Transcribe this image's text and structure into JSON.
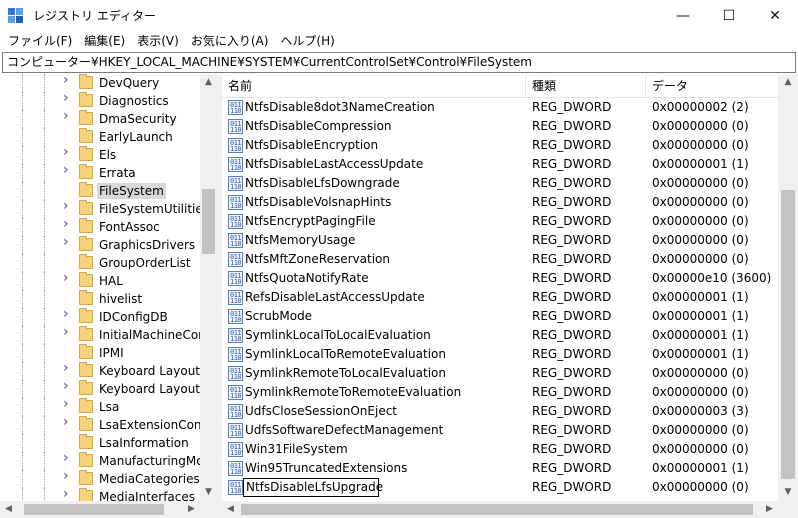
{
  "window": {
    "title": "レジストリ エディター",
    "minimize_glyph": "—",
    "maximize_glyph": "☐",
    "close_glyph": "✕"
  },
  "menu": [
    "ファイル(F)",
    "編集(E)",
    "表示(V)",
    "お気に入り(A)",
    "ヘルプ(H)"
  ],
  "address": "コンピューター¥HKEY_LOCAL_MACHINE¥SYSTEM¥CurrentControlSet¥Control¥FileSystem",
  "tree": {
    "items": [
      {
        "label": "DevQuery",
        "expandable": true
      },
      {
        "label": "Diagnostics",
        "expandable": true
      },
      {
        "label": "DmaSecurity",
        "expandable": true
      },
      {
        "label": "EarlyLaunch",
        "expandable": false
      },
      {
        "label": "Els",
        "expandable": true
      },
      {
        "label": "Errata",
        "expandable": true
      },
      {
        "label": "FileSystem",
        "expandable": false,
        "selected": true
      },
      {
        "label": "FileSystemUtilities",
        "expandable": true
      },
      {
        "label": "FontAssoc",
        "expandable": true
      },
      {
        "label": "GraphicsDrivers",
        "expandable": true
      },
      {
        "label": "GroupOrderList",
        "expandable": false
      },
      {
        "label": "HAL",
        "expandable": true
      },
      {
        "label": "hivelist",
        "expandable": false
      },
      {
        "label": "IDConfigDB",
        "expandable": true
      },
      {
        "label": "InitialMachineConf",
        "expandable": true
      },
      {
        "label": "IPMI",
        "expandable": false
      },
      {
        "label": "Keyboard Layout",
        "expandable": true
      },
      {
        "label": "Keyboard Layouts",
        "expandable": true
      },
      {
        "label": "Lsa",
        "expandable": true
      },
      {
        "label": "LsaExtensionConfig",
        "expandable": true
      },
      {
        "label": "LsaInformation",
        "expandable": false
      },
      {
        "label": "ManufacturingMod",
        "expandable": true
      },
      {
        "label": "MediaCategories",
        "expandable": true
      },
      {
        "label": "MediaInterfaces",
        "expandable": true
      }
    ]
  },
  "list": {
    "columns": {
      "name": "名前",
      "type": "種類",
      "data": "データ"
    },
    "rows": [
      {
        "name": "NtfsDisable8dot3NameCreation",
        "type": "REG_DWORD",
        "data": "0x00000002 (2)"
      },
      {
        "name": "NtfsDisableCompression",
        "type": "REG_DWORD",
        "data": "0x00000000 (0)"
      },
      {
        "name": "NtfsDisableEncryption",
        "type": "REG_DWORD",
        "data": "0x00000000 (0)"
      },
      {
        "name": "NtfsDisableLastAccessUpdate",
        "type": "REG_DWORD",
        "data": "0x00000001 (1)"
      },
      {
        "name": "NtfsDisableLfsDowngrade",
        "type": "REG_DWORD",
        "data": "0x00000000 (0)"
      },
      {
        "name": "NtfsDisableVolsnapHints",
        "type": "REG_DWORD",
        "data": "0x00000000 (0)"
      },
      {
        "name": "NtfsEncryptPagingFile",
        "type": "REG_DWORD",
        "data": "0x00000000 (0)"
      },
      {
        "name": "NtfsMemoryUsage",
        "type": "REG_DWORD",
        "data": "0x00000000 (0)"
      },
      {
        "name": "NtfsMftZoneReservation",
        "type": "REG_DWORD",
        "data": "0x00000000 (0)"
      },
      {
        "name": "NtfsQuotaNotifyRate",
        "type": "REG_DWORD",
        "data": "0x00000e10 (3600)"
      },
      {
        "name": "RefsDisableLastAccessUpdate",
        "type": "REG_DWORD",
        "data": "0x00000001 (1)"
      },
      {
        "name": "ScrubMode",
        "type": "REG_DWORD",
        "data": "0x00000001 (1)"
      },
      {
        "name": "SymlinkLocalToLocalEvaluation",
        "type": "REG_DWORD",
        "data": "0x00000001 (1)"
      },
      {
        "name": "SymlinkLocalToRemoteEvaluation",
        "type": "REG_DWORD",
        "data": "0x00000001 (1)"
      },
      {
        "name": "SymlinkRemoteToLocalEvaluation",
        "type": "REG_DWORD",
        "data": "0x00000000 (0)"
      },
      {
        "name": "SymlinkRemoteToRemoteEvaluation",
        "type": "REG_DWORD",
        "data": "0x00000000 (0)"
      },
      {
        "name": "UdfsCloseSessionOnEject",
        "type": "REG_DWORD",
        "data": "0x00000003 (3)"
      },
      {
        "name": "UdfsSoftwareDefectManagement",
        "type": "REG_DWORD",
        "data": "0x00000000 (0)"
      },
      {
        "name": "Win31FileSystem",
        "type": "REG_DWORD",
        "data": "0x00000000 (0)"
      },
      {
        "name": "Win95TruncatedExtensions",
        "type": "REG_DWORD",
        "data": "0x00000001 (1)"
      },
      {
        "name": "NtfsDisableLfsUpgrade",
        "type": "REG_DWORD",
        "data": "0x00000000 (0)",
        "editing": true
      }
    ]
  },
  "icons": {
    "reg_value": "reg-dword-icon",
    "folder": "folder-icon",
    "expand": "chevron-right-icon"
  }
}
